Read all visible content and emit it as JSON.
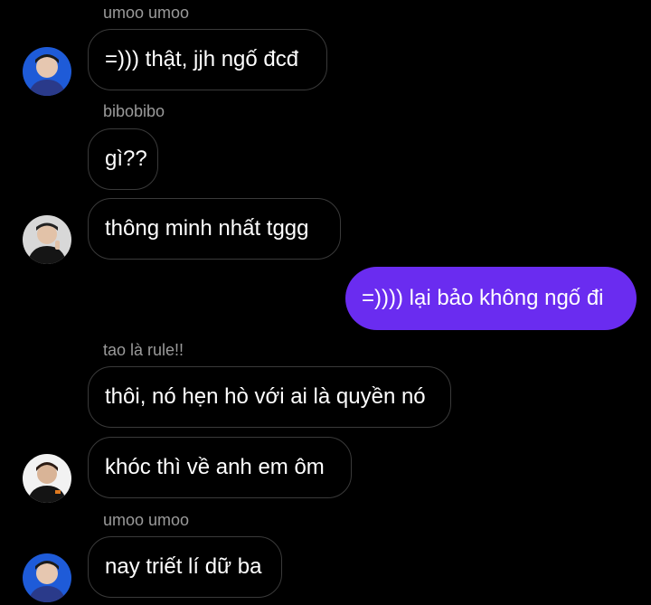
{
  "chat": {
    "messages": [
      {
        "sender": "umoo umoo",
        "text": "=))) thật, jjh ngố đcđ"
      },
      {
        "sender": "bibobibo",
        "text": "gì??"
      },
      {
        "text": "thông minh nhất tggg"
      },
      {
        "text": "=)))) lại bảo không ngố đi",
        "outgoing": true
      },
      {
        "sender": "tao là rule!!",
        "text": "thôi, nó hẹn hò với ai là quyền nó"
      },
      {
        "text": "khóc thì về anh em ôm"
      },
      {
        "sender": "umoo umoo",
        "text": "nay triết lí dữ ba"
      }
    ]
  },
  "avatars": {
    "umoo": "avatar-blue-jersey",
    "bibobibo": "avatar-black-jersey",
    "rule": "avatar-white-background"
  },
  "colors": {
    "background": "#000000",
    "incoming_border": "#3a3a3a",
    "outgoing_bubble": "#6a2cf0",
    "sender_text": "#9a9a9a",
    "message_text": "#ffffff"
  }
}
